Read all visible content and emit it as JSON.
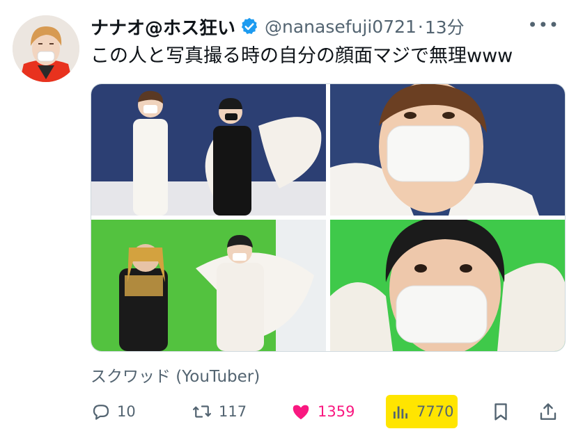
{
  "tweet": {
    "display_name": "ナナオ@ホス狂い",
    "handle": "@nanasefuji0721",
    "separator": "·",
    "time": "13分",
    "more_icon": "more-icon",
    "text": "この人と写真撮る時の自分の顔面マジで無理www",
    "tag": "スクワッド (YouTuber)",
    "accent_color": "#1d9bf0",
    "like_color": "#f91880",
    "highlight_color": "#ffe500"
  },
  "actions": {
    "reply": {
      "count": "10",
      "icon": "reply-icon"
    },
    "retweet": {
      "count": "117",
      "icon": "retweet-icon"
    },
    "like": {
      "count": "1359",
      "icon": "heart-icon"
    },
    "views": {
      "count": "7770",
      "icon": "views-icon"
    },
    "bookmark": {
      "icon": "bookmark-icon"
    },
    "share": {
      "icon": "share-icon"
    }
  },
  "media": {
    "photos": [
      "photo-1",
      "photo-2",
      "photo-3",
      "photo-4"
    ]
  }
}
